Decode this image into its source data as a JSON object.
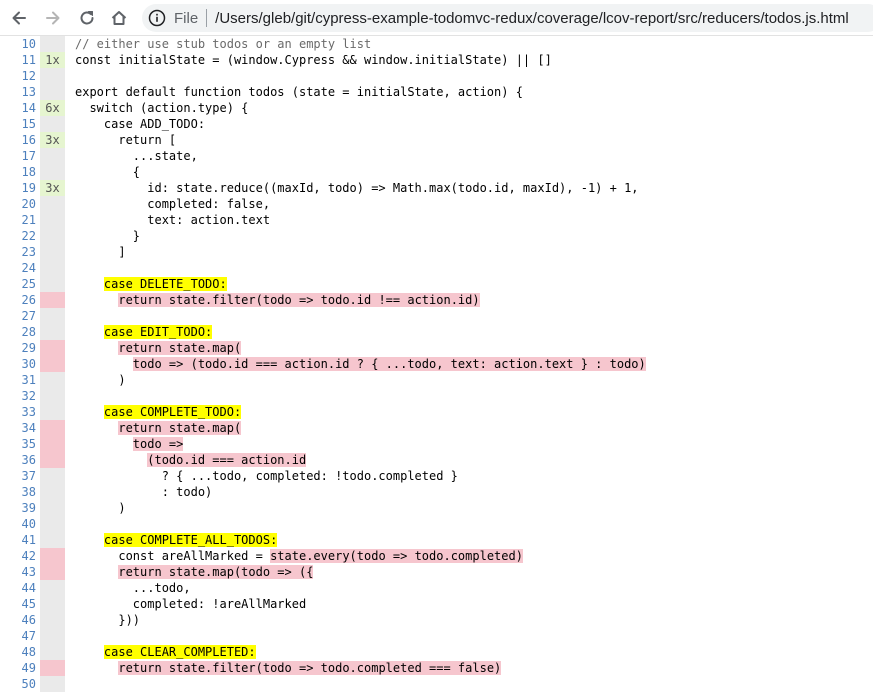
{
  "toolbar": {
    "scheme": "File",
    "url": "/Users/gleb/git/cypress-example-todomvc-redux/coverage/lcov-report/src/reducers/todos.js.html"
  },
  "colors": {
    "covered": "#e6f5d0",
    "uncovered": "#f6c6ce",
    "branch_not_taken": "#ffff00",
    "line_number": "#4d80bd"
  },
  "lines": [
    {
      "n": "10",
      "hits": "",
      "cov": "",
      "segs": [
        {
          "t": "// either use stub todos or an empty list",
          "h": ""
        }
      ]
    },
    {
      "n": "11",
      "hits": "1x",
      "cov": "covered",
      "segs": [
        {
          "t": "const initialState = (window.Cypress && window.initialState) || []",
          "h": ""
        }
      ]
    },
    {
      "n": "12",
      "hits": "",
      "cov": "",
      "segs": [
        {
          "t": "",
          "h": ""
        }
      ]
    },
    {
      "n": "13",
      "hits": "",
      "cov": "",
      "segs": [
        {
          "t": "export default function todos (state = initialState, action) {",
          "h": ""
        }
      ]
    },
    {
      "n": "14",
      "hits": "6x",
      "cov": "covered",
      "segs": [
        {
          "t": "  switch (action.type) {",
          "h": ""
        }
      ]
    },
    {
      "n": "15",
      "hits": "",
      "cov": "",
      "segs": [
        {
          "t": "    case ADD_TODO:",
          "h": ""
        }
      ]
    },
    {
      "n": "16",
      "hits": "3x",
      "cov": "covered",
      "segs": [
        {
          "t": "      return [",
          "h": ""
        }
      ]
    },
    {
      "n": "17",
      "hits": "",
      "cov": "",
      "segs": [
        {
          "t": "        ...state,",
          "h": ""
        }
      ]
    },
    {
      "n": "18",
      "hits": "",
      "cov": "",
      "segs": [
        {
          "t": "        {",
          "h": ""
        }
      ]
    },
    {
      "n": "19",
      "hits": "3x",
      "cov": "covered",
      "segs": [
        {
          "t": "          id: state.reduce((maxId, todo) => Math.max(todo.id, maxId), -1) + 1,",
          "h": ""
        }
      ]
    },
    {
      "n": "20",
      "hits": "",
      "cov": "",
      "segs": [
        {
          "t": "          completed: false,",
          "h": ""
        }
      ]
    },
    {
      "n": "21",
      "hits": "",
      "cov": "",
      "segs": [
        {
          "t": "          text: action.text",
          "h": ""
        }
      ]
    },
    {
      "n": "22",
      "hits": "",
      "cov": "",
      "segs": [
        {
          "t": "        }",
          "h": ""
        }
      ]
    },
    {
      "n": "23",
      "hits": "",
      "cov": "",
      "segs": [
        {
          "t": "      ]",
          "h": ""
        }
      ]
    },
    {
      "n": "24",
      "hits": "",
      "cov": "",
      "segs": [
        {
          "t": "",
          "h": ""
        }
      ]
    },
    {
      "n": "25",
      "hits": "",
      "cov": "",
      "segs": [
        {
          "t": "    case DELETE_TODO:",
          "h": "yellow"
        }
      ]
    },
    {
      "n": "26",
      "hits": "",
      "cov": "uncovered",
      "segs": [
        {
          "t": "      return state.filter(todo => todo.id !== action.id)",
          "h": "pink"
        }
      ]
    },
    {
      "n": "27",
      "hits": "",
      "cov": "",
      "segs": [
        {
          "t": "",
          "h": ""
        }
      ]
    },
    {
      "n": "28",
      "hits": "",
      "cov": "",
      "segs": [
        {
          "t": "    case EDIT_TODO:",
          "h": "yellow"
        }
      ]
    },
    {
      "n": "29",
      "hits": "",
      "cov": "uncovered",
      "segs": [
        {
          "t": "      return state.map(",
          "h": "pink"
        }
      ]
    },
    {
      "n": "30",
      "hits": "",
      "cov": "uncovered",
      "segs": [
        {
          "t": "        todo => ",
          "h": "pink"
        },
        {
          "t": "(todo.id === action.id ? { ...todo, text: action.text } : todo)",
          "h": "pink"
        }
      ]
    },
    {
      "n": "31",
      "hits": "",
      "cov": "",
      "segs": [
        {
          "t": "      )",
          "h": ""
        }
      ]
    },
    {
      "n": "32",
      "hits": "",
      "cov": "",
      "segs": [
        {
          "t": "",
          "h": ""
        }
      ]
    },
    {
      "n": "33",
      "hits": "",
      "cov": "",
      "segs": [
        {
          "t": "    case COMPLETE_TODO:",
          "h": "yellow"
        }
      ]
    },
    {
      "n": "34",
      "hits": "",
      "cov": "uncovered",
      "segs": [
        {
          "t": "      return state.map(",
          "h": "pink"
        }
      ]
    },
    {
      "n": "35",
      "hits": "",
      "cov": "uncovered",
      "segs": [
        {
          "t": "        todo =>",
          "h": "pink"
        }
      ]
    },
    {
      "n": "36",
      "hits": "",
      "cov": "uncovered",
      "segs": [
        {
          "t": "          (",
          "h": "pink"
        },
        {
          "t": "todo.id === action.id",
          "h": "pink"
        }
      ]
    },
    {
      "n": "37",
      "hits": "",
      "cov": "",
      "segs": [
        {
          "t": "            ? { ...todo, completed: !todo.completed }",
          "h": ""
        }
      ]
    },
    {
      "n": "38",
      "hits": "",
      "cov": "",
      "segs": [
        {
          "t": "            : todo)",
          "h": ""
        }
      ]
    },
    {
      "n": "39",
      "hits": "",
      "cov": "",
      "segs": [
        {
          "t": "      )",
          "h": ""
        }
      ]
    },
    {
      "n": "40",
      "hits": "",
      "cov": "",
      "segs": [
        {
          "t": "",
          "h": ""
        }
      ]
    },
    {
      "n": "41",
      "hits": "",
      "cov": "",
      "segs": [
        {
          "t": "    case COMPLETE_ALL_TODOS:",
          "h": "yellow"
        }
      ]
    },
    {
      "n": "42",
      "hits": "",
      "cov": "uncovered",
      "segs": [
        {
          "t": "      const areAllMarked = ",
          "h": ""
        },
        {
          "t": "state.every(todo => todo.completed)",
          "h": "pink"
        }
      ]
    },
    {
      "n": "43",
      "hits": "",
      "cov": "uncovered",
      "segs": [
        {
          "t": "      return state.map(todo => ({",
          "h": "pink"
        }
      ]
    },
    {
      "n": "44",
      "hits": "",
      "cov": "",
      "segs": [
        {
          "t": "        ...todo,",
          "h": ""
        }
      ]
    },
    {
      "n": "45",
      "hits": "",
      "cov": "",
      "segs": [
        {
          "t": "        completed: !areAllMarked",
          "h": ""
        }
      ]
    },
    {
      "n": "46",
      "hits": "",
      "cov": "",
      "segs": [
        {
          "t": "      }))",
          "h": ""
        }
      ]
    },
    {
      "n": "47",
      "hits": "",
      "cov": "",
      "segs": [
        {
          "t": "",
          "h": ""
        }
      ]
    },
    {
      "n": "48",
      "hits": "",
      "cov": "",
      "segs": [
        {
          "t": "    case CLEAR_COMPLETED:",
          "h": "yellow"
        }
      ]
    },
    {
      "n": "49",
      "hits": "",
      "cov": "uncovered",
      "segs": [
        {
          "t": "      return state.filter(todo => todo.completed === false)",
          "h": "pink"
        }
      ]
    },
    {
      "n": "50",
      "hits": "",
      "cov": "",
      "segs": [
        {
          "t": "",
          "h": ""
        }
      ]
    }
  ]
}
